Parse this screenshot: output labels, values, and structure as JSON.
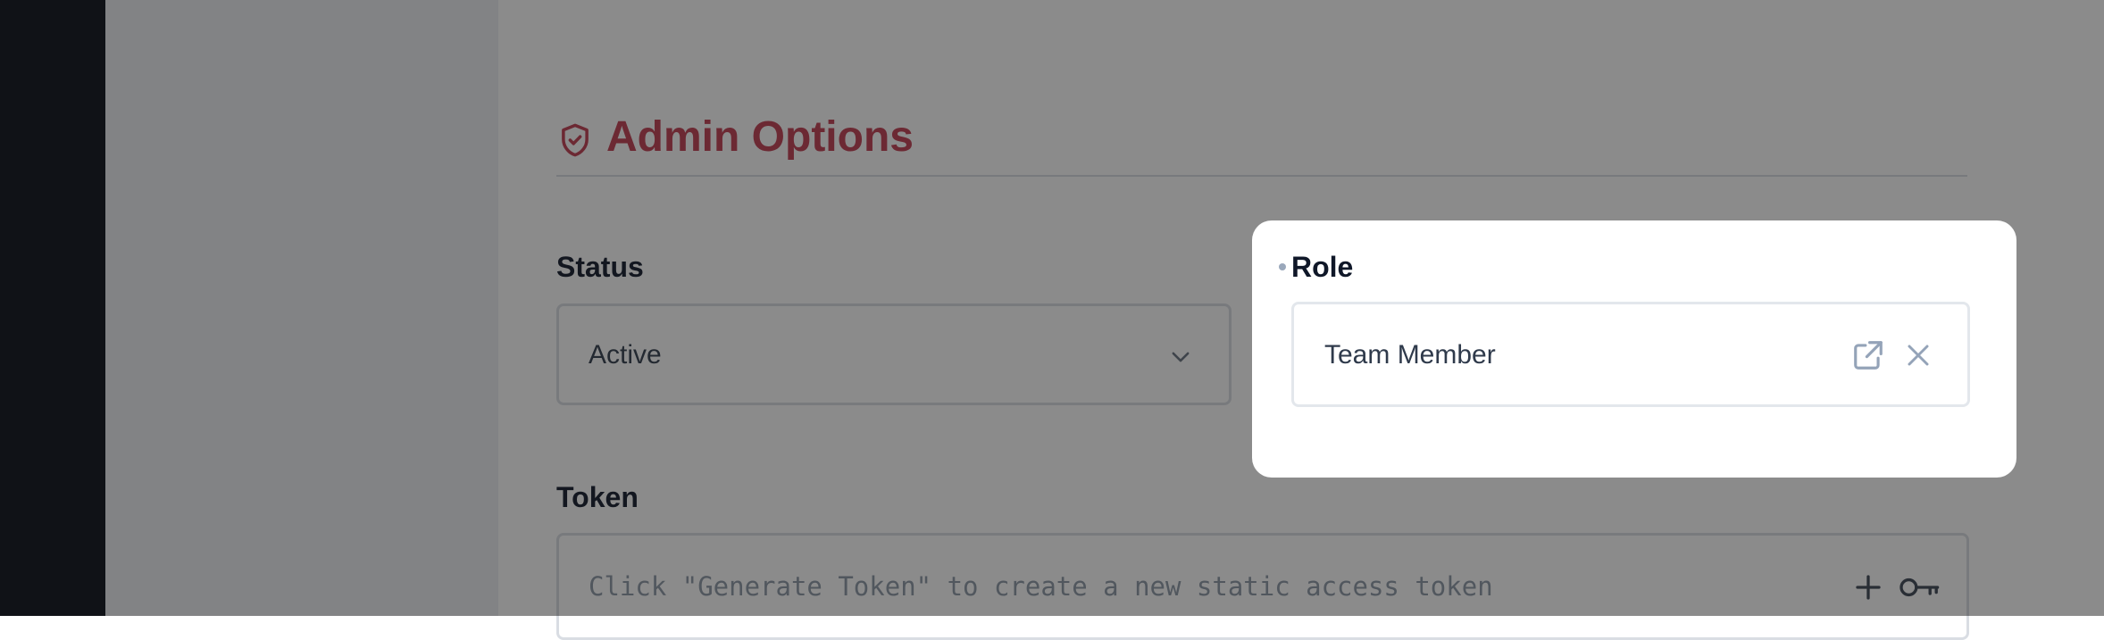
{
  "admin_section": {
    "title": "Admin Options",
    "icon": "shield-check-icon",
    "accent_color": "#c03a4f"
  },
  "status_field": {
    "label": "Status",
    "value": "Active",
    "icon": "chevron-down-icon"
  },
  "role_field": {
    "label": "Role",
    "value": "Team Member",
    "icons": [
      "external-link-icon",
      "close-icon"
    ]
  },
  "token_field": {
    "label": "Token",
    "placeholder": "Click \"Generate Token\" to create a new static access token",
    "icons": [
      "plus-icon",
      "key-icon"
    ]
  }
}
